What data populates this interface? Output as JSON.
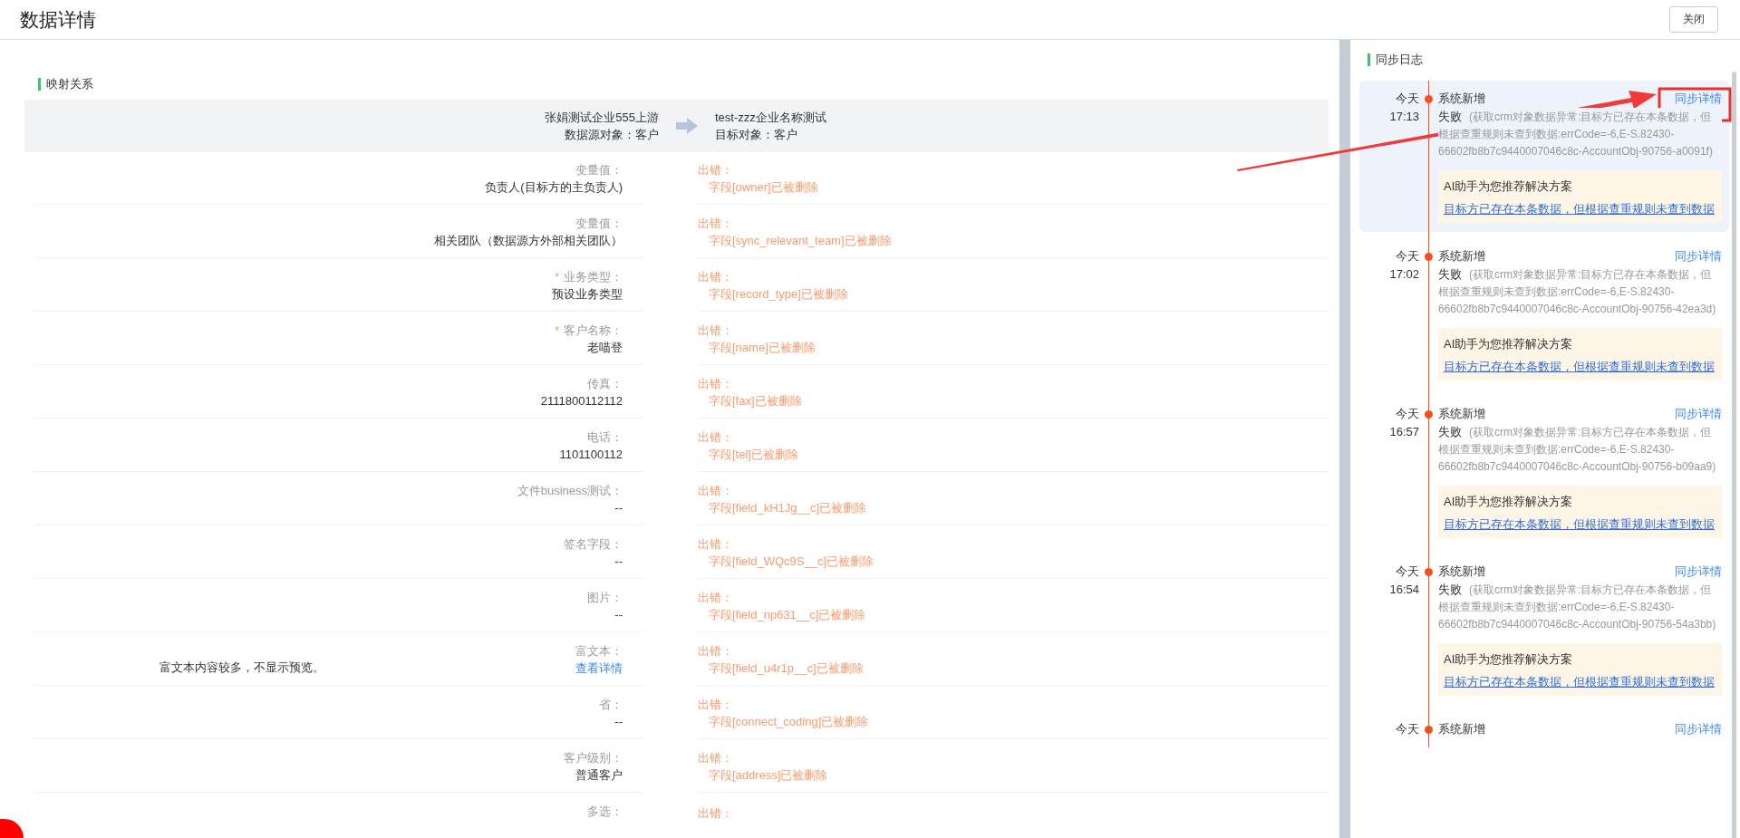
{
  "header": {
    "title": "数据详情",
    "close_button": "关闭"
  },
  "mapping": {
    "title": "映射关系",
    "source": {
      "name": "张娟测试企业555上游",
      "object": "数据源对象：客户"
    },
    "target": {
      "name": "test-zzz企业名称测试",
      "object": "目标对象：客户"
    },
    "rows": [
      {
        "label": "变量值：",
        "required": false,
        "value": "负责人(目标方的主负责人)",
        "kind": "text",
        "error_title": "出错：",
        "error": "字段[owner]已被删除"
      },
      {
        "label": "变量值：",
        "required": false,
        "value": "相关团队（数据源方外部相关团队）",
        "kind": "text",
        "error_title": "出错：",
        "error": "字段[sync_relevant_team]已被删除"
      },
      {
        "label": "业务类型：",
        "required": true,
        "required_mark": "*",
        "value": "预设业务类型",
        "kind": "text",
        "error_title": "出错：",
        "error": "字段[record_type]已被删除"
      },
      {
        "label": "客户名称：",
        "required": true,
        "required_mark": "*",
        "value": "老喵登",
        "kind": "text",
        "error_title": "出错：",
        "error": "字段[name]已被删除"
      },
      {
        "label": "传真：",
        "required": false,
        "value": "2111800112112",
        "kind": "text",
        "error_title": "出错：",
        "error": "字段[fax]已被删除"
      },
      {
        "label": "电话：",
        "required": false,
        "value": "1101100112",
        "kind": "text",
        "error_title": "出错：",
        "error": "字段[tel]已被删除"
      },
      {
        "label": "文件business测试：",
        "required": false,
        "value": "--",
        "kind": "text",
        "error_title": "出错：",
        "error": "字段[field_kH1Jg__c]已被删除"
      },
      {
        "label": "签名字段：",
        "required": false,
        "value": "--",
        "kind": "text",
        "error_title": "出错：",
        "error": "字段[field_WQc9S__c]已被删除"
      },
      {
        "label": "图片：",
        "required": false,
        "value": "--",
        "kind": "text",
        "error_title": "出错：",
        "error": "字段[field_np631__c]已被删除"
      },
      {
        "label": "富文本：",
        "required": false,
        "note": "富文本内容较多，不显示预览。",
        "value": "查看详情",
        "kind": "link",
        "error_title": "出错：",
        "error": "字段[field_u4r1p__c]已被删除"
      },
      {
        "label": "省：",
        "required": false,
        "value": "--",
        "kind": "text",
        "error_title": "出错：",
        "error": "字段[connect_coding]已被删除"
      },
      {
        "label": "客户级别：",
        "required": false,
        "value": "普通客户",
        "kind": "text",
        "error_title": "出错：",
        "error": "字段[address]已被删除"
      },
      {
        "label": "多选：",
        "required": false,
        "error_title": "出错："
      }
    ]
  },
  "sync_log": {
    "title": "同步日志",
    "entries": [
      {
        "selected": true,
        "day": "今天",
        "time": "17:13",
        "title": "系统新增",
        "link": "同步详情",
        "status": "失败",
        "message": "(获取crm对象数据异常:目标方已存在本条数据，但根据查重规则未查到数据:errCode=-6,E-S.82430-66602fb8b7c9440007046c8c-AccountObj-90756-a0091f)",
        "ai_title": "AI助手为您推荐解决方案",
        "ai_link": "目标方已存在本条数据，但根据查重规则未查到数据"
      },
      {
        "selected": false,
        "day": "今天",
        "time": "17:02",
        "title": "系统新增",
        "link": "同步详情",
        "status": "失败",
        "message": "(获取crm对象数据异常:目标方已存在本条数据，但根据查重规则未查到数据:errCode=-6,E-S.82430-66602fb8b7c9440007046c8c-AccountObj-90756-42ea3d)",
        "ai_title": "AI助手为您推荐解决方案",
        "ai_link": "目标方已存在本条数据，但根据查重规则未查到数据"
      },
      {
        "selected": false,
        "day": "今天",
        "time": "16:57",
        "title": "系统新增",
        "link": "同步详情",
        "status": "失败",
        "message": "(获取crm对象数据异常:目标方已存在本条数据，但根据查重规则未查到数据:errCode=-6,E-S.82430-66602fb8b7c9440007046c8c-AccountObj-90756-b09aa9)",
        "ai_title": "AI助手为您推荐解决方案",
        "ai_link": "目标方已存在本条数据，但根据查重规则未查到数据"
      },
      {
        "selected": false,
        "day": "今天",
        "time": "16:54",
        "title": "系统新增",
        "link": "同步详情",
        "status": "失败",
        "message": "(获取crm对象数据异常:目标方已存在本条数据，但根据查重规则未查到数据:errCode=-6,E-S.82430-66602fb8b7c9440007046c8c-AccountObj-90756-54a3bb)",
        "ai_title": "AI助手为您推荐解决方案",
        "ai_link": "目标方已存在本条数据，但根据查重规则未查到数据"
      },
      {
        "selected": false,
        "day": "今天",
        "title": "系统新增",
        "link": "同步详情"
      }
    ]
  }
}
